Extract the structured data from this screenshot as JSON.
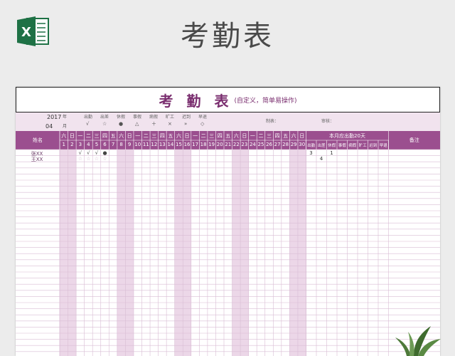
{
  "header": {
    "title": "考勤表"
  },
  "sheet": {
    "title": "考 勤 表",
    "subtitle": "(自定义，简单易操作)",
    "year": "2017",
    "year_label": "年",
    "month": "04",
    "month_label": "月",
    "legend": [
      {
        "label": "出勤",
        "symbol": "√"
      },
      {
        "label": "出差",
        "symbol": "☆"
      },
      {
        "label": "休假",
        "symbol": "●"
      },
      {
        "label": "事假",
        "symbol": "△"
      },
      {
        "label": "病假",
        "symbol": "＋"
      },
      {
        "label": "旷工",
        "symbol": "×"
      },
      {
        "label": "迟到",
        "symbol": "»"
      },
      {
        "label": "早退",
        "symbol": "◇"
      }
    ],
    "tabulator_label": "制表：",
    "reviewer_label": "审核：",
    "name_header": "姓名",
    "weekdays": [
      "六",
      "日",
      "一",
      "二",
      "三",
      "四",
      "五",
      "六",
      "日",
      "一",
      "二",
      "三",
      "四",
      "五",
      "六",
      "日",
      "一",
      "二",
      "三",
      "四",
      "五",
      "六",
      "日",
      "一",
      "二",
      "三",
      "四",
      "五",
      "六",
      "日"
    ],
    "days": [
      "1",
      "2",
      "3",
      "4",
      "5",
      "6",
      "7",
      "8",
      "9",
      "10",
      "11",
      "12",
      "13",
      "14",
      "15",
      "16",
      "17",
      "18",
      "19",
      "20",
      "21",
      "22",
      "23",
      "24",
      "25",
      "26",
      "27",
      "28",
      "29",
      "30"
    ],
    "summary_header": "本月应出勤20天",
    "summary_columns": [
      "出勤",
      "出差",
      "休假",
      "事假",
      "病假",
      "旷工",
      "迟到",
      "早退"
    ],
    "remark_header": "备注",
    "rows": [
      {
        "name": "张XX",
        "marks": [
          {
            "day": 3,
            "symbol": "√"
          },
          {
            "day": 4,
            "symbol": "√"
          },
          {
            "day": 5,
            "symbol": "√"
          },
          {
            "day": 6,
            "symbol": "●"
          }
        ],
        "summary": {
          "出勤": "3",
          "休假": "1"
        }
      },
      {
        "name": "王XX",
        "marks": [
          {
            "day": 3,
            "symbol": "☆"
          },
          {
            "day": 4,
            "symbol": "☆"
          },
          {
            "day": 5,
            "symbol": "☆"
          },
          {
            "day": 6,
            "symbol": "☆"
          }
        ],
        "summary": {
          "出差": "4"
        }
      }
    ]
  },
  "colors": {
    "header_purple": "#9b4f8f",
    "weekend_pink": "#ecd7e8",
    "line_purple": "#d9bdd4",
    "excel_green": "#1e7145"
  }
}
